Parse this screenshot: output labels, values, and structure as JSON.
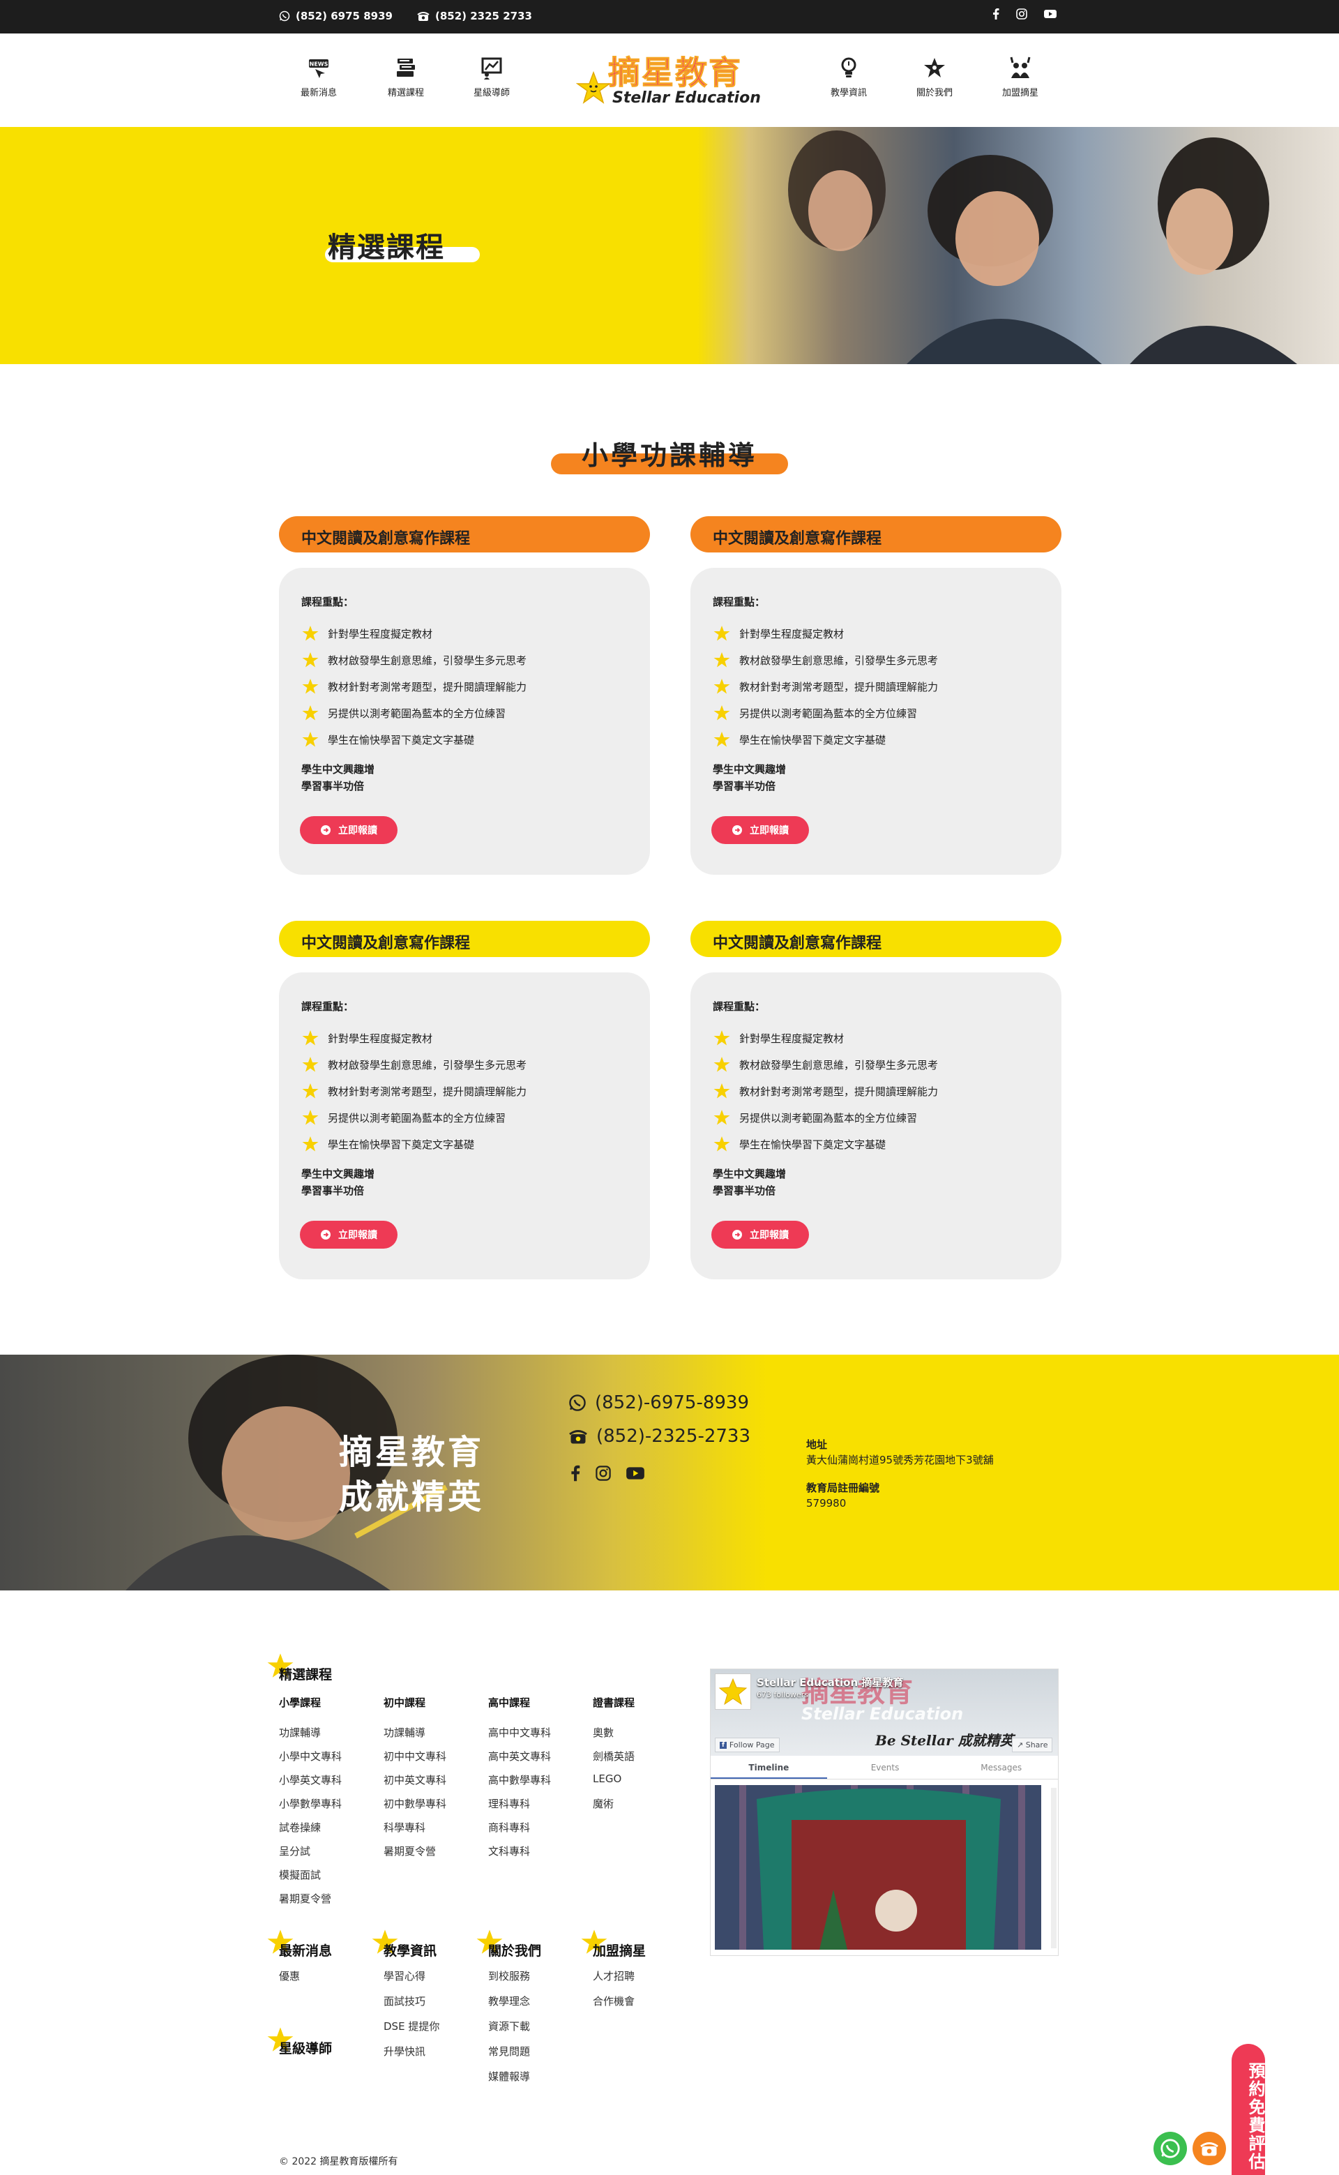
{
  "topbar": {
    "whatsapp": "(852) 6975 8939",
    "phone": "(852) 2325 2733"
  },
  "nav": {
    "left": [
      "最新消息",
      "精選課程",
      "星級導師"
    ],
    "right": [
      "教學資訊",
      "關於我們",
      "加盟摘星"
    ]
  },
  "logo": {
    "zh": "摘星教育",
    "en": "Stellar Education"
  },
  "hero": {
    "title": "精選課程"
  },
  "section": {
    "title": "小學功課輔導"
  },
  "cards": [
    {
      "title": "中文閱讀及創意寫作課程",
      "label": "課程重點：",
      "points": [
        "針對學生程度擬定教材",
        "教材啟發學生創意思維，引發學生多元思考",
        "教材針對考測常考題型，提升閱讀理解能力",
        "另提供以測考範圍為藍本的全方位練習",
        "學生在愉快學習下奠定文字基礎"
      ],
      "em1": "學生中文興趣增",
      "em2": "學習事半功倍",
      "button": "立即報讀"
    },
    {
      "title": "中文閱讀及創意寫作課程",
      "label": "課程重點：",
      "points": [
        "針對學生程度擬定教材",
        "教材啟發學生創意思維，引發學生多元思考",
        "教材針對考測常考題型，提升閱讀理解能力",
        "另提供以測考範圍為藍本的全方位練習",
        "學生在愉快學習下奠定文字基礎"
      ],
      "em1": "學生中文興趣增",
      "em2": "學習事半功倍",
      "button": "立即報讀"
    },
    {
      "title": "中文閱讀及創意寫作課程",
      "label": "課程重點：",
      "points": [
        "針對學生程度擬定教材",
        "教材啟發學生創意思維，引發學生多元思考",
        "教材針對考測常考題型，提升閱讀理解能力",
        "另提供以測考範圍為藍本的全方位練習",
        "學生在愉快學習下奠定文字基礎"
      ],
      "em1": "學生中文興趣增",
      "em2": "學習事半功倍",
      "button": "立即報讀"
    },
    {
      "title": "中文閱讀及創意寫作課程",
      "label": "課程重點：",
      "points": [
        "針對學生程度擬定教材",
        "教材啟發學生創意思維，引發學生多元思考",
        "教材針對考測常考題型，提升閱讀理解能力",
        "另提供以測考範圍為藍本的全方位練習",
        "學生在愉快學習下奠定文字基礎"
      ],
      "em1": "學生中文興趣增",
      "em2": "學習事半功倍",
      "button": "立即報讀"
    }
  ],
  "colors": {
    "orange": "#f5841f",
    "yellow": "#f8e000",
    "red": "#ee3a55"
  },
  "band": {
    "slogan1": "摘星教育",
    "slogan2": "成就精英",
    "whatsapp": "(852)-6975-8939",
    "phone": "(852)-2325-2733",
    "addr_label": "地址",
    "addr": "黃大仙蒲崗村道95號秀芳花園地下3號舖",
    "reg_label": "教育局註冊編號",
    "reg": "579980"
  },
  "footer": {
    "courses_title": "精選課程",
    "columns": [
      {
        "head": "小學課程",
        "items": [
          "功課輔導",
          "小學中文專科",
          "小學英文專科",
          "小學數學專科",
          "試卷操練",
          "呈分試",
          "模擬面試",
          "暑期夏令營"
        ]
      },
      {
        "head": "初中課程",
        "items": [
          "功課輔導",
          "初中中文專科",
          "初中英文專科",
          "初中數學專科",
          "科學專科",
          "暑期夏令營"
        ]
      },
      {
        "head": "高中課程",
        "items": [
          "高中中文專科",
          "高中英文專科",
          "高中數學專科",
          "理科專科",
          "商科專科",
          "文科專科"
        ]
      },
      {
        "head": "證書課程",
        "items": [
          "奧數",
          "劍橋英語",
          "LEGO",
          "魔術"
        ]
      }
    ],
    "sections": [
      {
        "title": "最新消息",
        "items": [
          "優惠"
        ]
      },
      {
        "title": "教學資訊",
        "items": [
          "學習心得",
          "面試技巧",
          "DSE 提提你",
          "升學快訊"
        ]
      },
      {
        "title": "關於我們",
        "items": [
          "到校服務",
          "教學理念",
          "資源下載",
          "常見問題",
          "媒體報導"
        ]
      },
      {
        "title": "加盟摘星",
        "items": [
          "人才招聘",
          "合作機會"
        ]
      },
      {
        "title": "星級導師",
        "items": []
      }
    ],
    "copyright": "© 2022 摘星教育版權所有"
  },
  "facebook": {
    "page_name": "Stellar Education 摘星教育",
    "followers": "673 followers",
    "follow": "Follow Page",
    "share": "Share",
    "cover_zh": "摘星教育",
    "cover_en": "Stellar Education",
    "cover_slogan": "Be Stellar 成就精英",
    "tabs": [
      "Timeline",
      "Events",
      "Messages"
    ]
  },
  "floating": {
    "booking": "預約免費評估"
  }
}
